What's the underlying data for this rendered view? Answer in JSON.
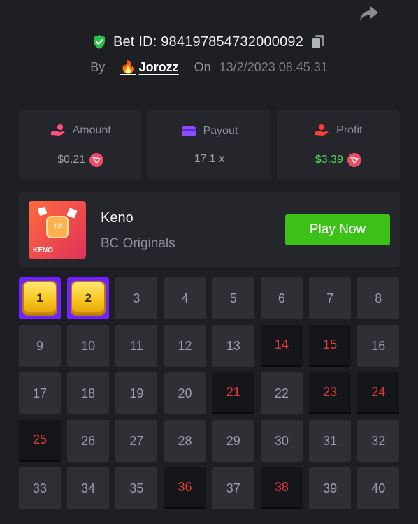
{
  "header": {
    "bet_id_label": "Bet ID: 984197854732000092",
    "by_label": "By",
    "user_name": "Jorozz",
    "user_emoji": "🔥",
    "on_label": "On",
    "date": "13/2/2023 08.45.31"
  },
  "stats": {
    "amount": {
      "label": "Amount",
      "value": "$0.21",
      "icon": "hand-coins-icon",
      "coin": "tron-coin-icon"
    },
    "payout": {
      "label": "Payout",
      "value": "17.1 x",
      "icon": "wallet-card-icon"
    },
    "profit": {
      "label": "Profit",
      "value": "$3.39",
      "icon": "profit-hand-icon",
      "coin": "tron-coin-icon"
    }
  },
  "game": {
    "name": "Keno",
    "provider": "BC Originals",
    "play_label": "Play Now",
    "thumb_text": "KENO",
    "thumb_number": "12"
  },
  "colors": {
    "background": "#1e1f22",
    "panel": "#24262b",
    "cell": "#2e3036",
    "cell_hit": "#15161a",
    "cell_picked": "#6f22ff",
    "hit_text": "#e23a3a",
    "play_button": "#3bc117",
    "profit_text": "#4fd55a",
    "shield": "#29c14a",
    "tron_coin": "#ef4b66"
  },
  "grid": {
    "numbers": [
      "1",
      "2",
      "3",
      "4",
      "5",
      "6",
      "7",
      "8",
      "9",
      "10",
      "11",
      "12",
      "13",
      "14",
      "15",
      "16",
      "17",
      "18",
      "19",
      "20",
      "21",
      "22",
      "23",
      "24",
      "25",
      "26",
      "27",
      "28",
      "29",
      "30",
      "31",
      "32",
      "33",
      "34",
      "35",
      "36",
      "37",
      "38",
      "39",
      "40"
    ],
    "picked": [
      1,
      2
    ],
    "drawn": [
      14,
      15,
      21,
      23,
      24,
      25,
      36,
      38
    ]
  }
}
